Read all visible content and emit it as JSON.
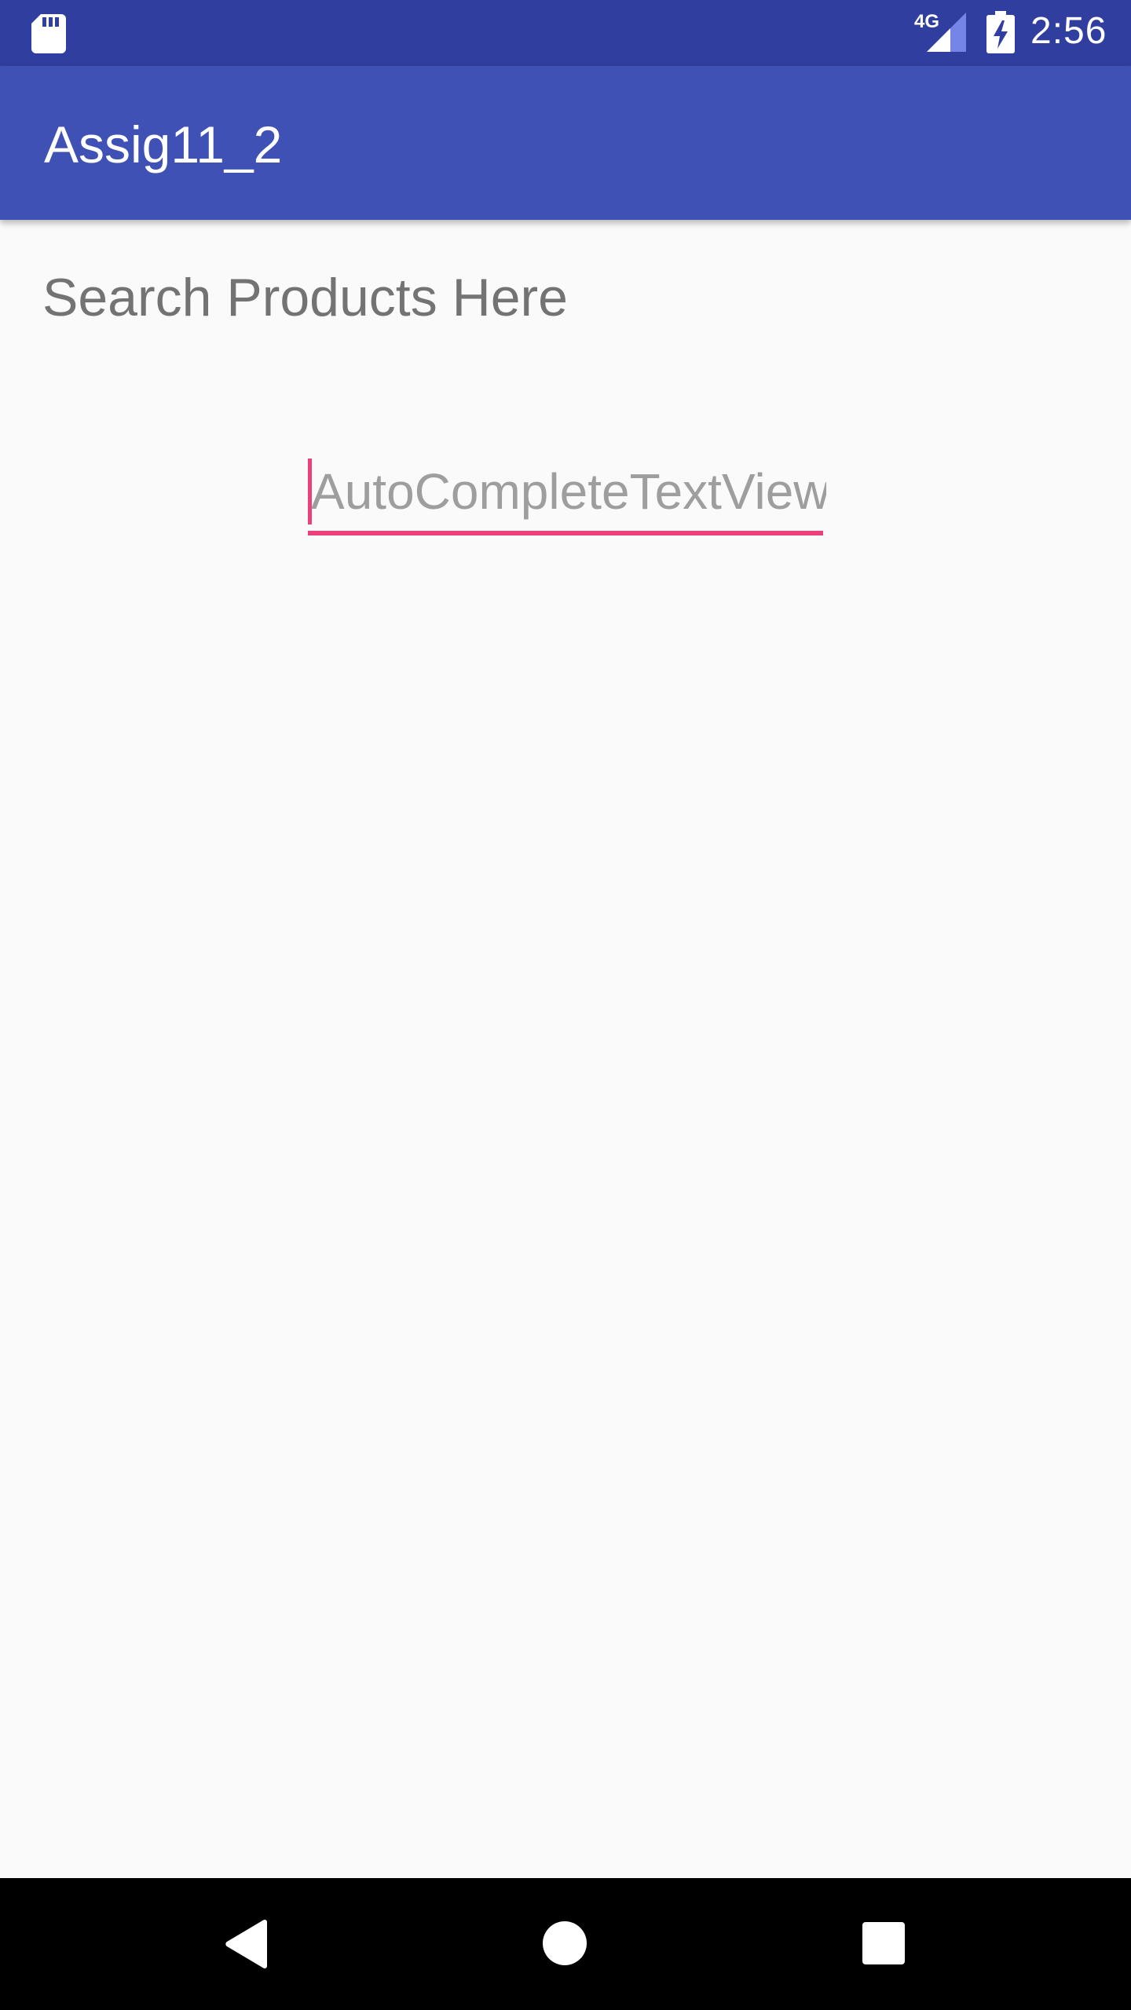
{
  "status_bar": {
    "network_type": "4G",
    "time": "2:56",
    "icons": [
      "sd-card-icon",
      "cellular-signal-icon",
      "battery-charging-icon"
    ]
  },
  "app_bar": {
    "title": "Assig11_2"
  },
  "content": {
    "heading": "Search Products Here",
    "search_field": {
      "value": "",
      "placeholder": "AutoCompleteTextView"
    }
  },
  "nav_bar": {
    "icons": [
      "back-icon",
      "home-icon",
      "recents-icon"
    ]
  },
  "colors": {
    "status_bar": "#303f9f",
    "app_bar": "#3f51b5",
    "accent": "#ec407a",
    "background": "#fafafa",
    "nav_bar": "#000000"
  }
}
